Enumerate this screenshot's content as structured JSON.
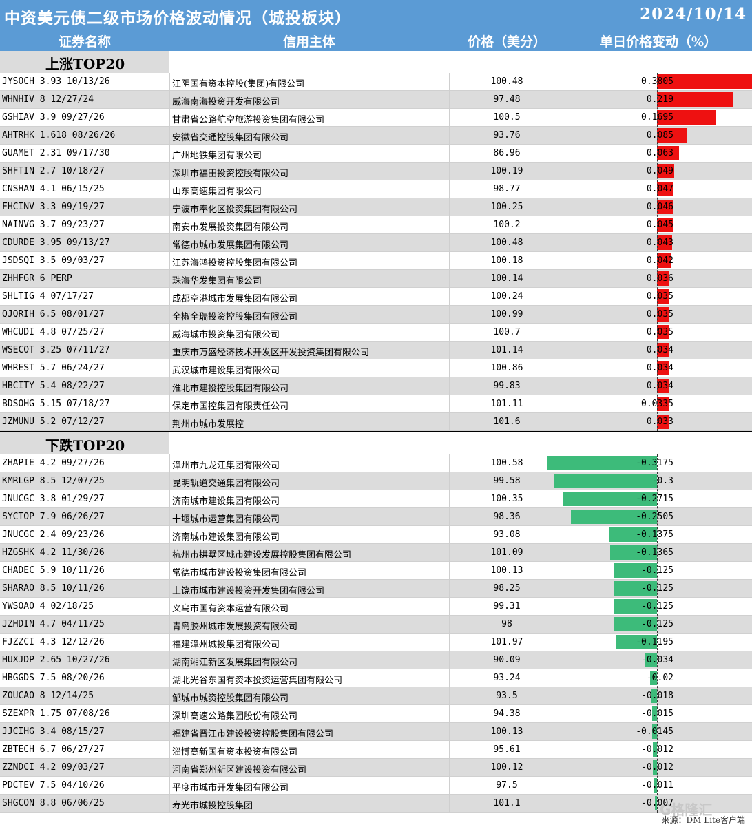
{
  "title": "中资美元债二级市场价格波动情况（城投板块）",
  "date": "2024/10/14",
  "columns": [
    "证券名称",
    "信用主体",
    "价格（美分）",
    "单日价格变动（%）"
  ],
  "sections": {
    "up_label": "上涨TOP20",
    "down_label": "下跌TOP20"
  },
  "colors": {
    "header": "#5b9bd5",
    "up": "#ee1111",
    "down": "#3dbb7a",
    "band": "#dcdcdc"
  },
  "chart_data": {
    "type": "table",
    "up": [
      {
        "bond": "JYSOCH 3.93 10/13/26",
        "issuer": "江阴国有资本控股(集团)有限公司",
        "price": "100.48",
        "change": "0.3805"
      },
      {
        "bond": "WHNHIV 8 12/27/24",
        "issuer": "威海南海投资开发有限公司",
        "price": "97.48",
        "change": "0.219"
      },
      {
        "bond": "GSHIAV 3.9 09/27/26",
        "issuer": "甘肃省公路航空旅游投资集团有限公司",
        "price": "100.5",
        "change": "0.1695"
      },
      {
        "bond": "AHTRHK 1.618 08/26/26",
        "issuer": "安徽省交通控股集团有限公司",
        "price": "93.76",
        "change": "0.085"
      },
      {
        "bond": "GUAMET 2.31 09/17/30",
        "issuer": "广州地铁集团有限公司",
        "price": "86.96",
        "change": "0.063"
      },
      {
        "bond": "SHFTIN 2.7 10/18/27",
        "issuer": "深圳市福田投资控股有限公司",
        "price": "100.19",
        "change": "0.049"
      },
      {
        "bond": "CNSHAN 4.1 06/15/25",
        "issuer": "山东高速集团有限公司",
        "price": "98.77",
        "change": "0.047"
      },
      {
        "bond": "FHCINV 3.3 09/19/27",
        "issuer": "宁波市奉化区投资集团有限公司",
        "price": "100.25",
        "change": "0.046"
      },
      {
        "bond": "NAINVG 3.7 09/23/27",
        "issuer": "南安市发展投资集团有限公司",
        "price": "100.2",
        "change": "0.045"
      },
      {
        "bond": "CDURDE 3.95 09/13/27",
        "issuer": "常德市城市发展集团有限公司",
        "price": "100.48",
        "change": "0.043"
      },
      {
        "bond": "JSDSQI 3.5 09/03/27",
        "issuer": "江苏海鸿投资控股集团有限公司",
        "price": "100.18",
        "change": "0.042"
      },
      {
        "bond": "ZHHFGR 6 PERP",
        "issuer": "珠海华发集团有限公司",
        "price": "100.14",
        "change": "0.036"
      },
      {
        "bond": "SHLTIG 4 07/17/27",
        "issuer": "成都空港城市发展集团有限公司",
        "price": "100.24",
        "change": "0.035"
      },
      {
        "bond": "QJQRIH 6.5 08/01/27",
        "issuer": "全椒全瑞投资控股集团有限公司",
        "price": "100.99",
        "change": "0.035"
      },
      {
        "bond": "WHCUDI 4.8 07/25/27",
        "issuer": "威海城市投资集团有限公司",
        "price": "100.7",
        "change": "0.035"
      },
      {
        "bond": "WSECOT 3.25 07/11/27",
        "issuer": "重庆市万盛经济技术开发区开发投资集团有限公司",
        "price": "101.14",
        "change": "0.034"
      },
      {
        "bond": "WHREST 5.7 06/24/27",
        "issuer": "武汉城市建设集团有限公司",
        "price": "100.86",
        "change": "0.034"
      },
      {
        "bond": "HBCITY 5.4 08/22/27",
        "issuer": "淮北市建投控股集团有限公司",
        "price": "99.83",
        "change": "0.034"
      },
      {
        "bond": "BDSOHG 5.15 07/18/27",
        "issuer": "保定市国控集团有限责任公司",
        "price": "101.11",
        "change": "0.0335"
      },
      {
        "bond": "JZMUNU 5.2 07/12/27",
        "issuer": "荆州市城市发展控",
        "price": "101.6",
        "change": "0.033"
      }
    ],
    "down": [
      {
        "bond": "ZHAPIE 4.2 09/27/26",
        "issuer": "漳州市九龙江集团有限公司",
        "price": "100.58",
        "change": "-0.3175"
      },
      {
        "bond": "KMRLGP 8.5 12/07/25",
        "issuer": "昆明轨道交通集团有限公司",
        "price": "99.58",
        "change": "-0.3"
      },
      {
        "bond": "JNUCGC 3.8 01/29/27",
        "issuer": "济南城市建设集团有限公司",
        "price": "100.35",
        "change": "-0.2715"
      },
      {
        "bond": "SYCTOP 7.9 06/26/27",
        "issuer": "十堰城市运营集团有限公司",
        "price": "98.36",
        "change": "-0.2505"
      },
      {
        "bond": "JNUCGC 2.4 09/23/26",
        "issuer": "济南城市建设集团有限公司",
        "price": "93.08",
        "change": "-0.1375"
      },
      {
        "bond": "HZGSHK 4.2 11/30/26",
        "issuer": "杭州市拱墅区城市建设发展控股集团有限公司",
        "price": "101.09",
        "change": "-0.1365"
      },
      {
        "bond": "CHADEC 5.9 10/11/26",
        "issuer": "常德市城市建设投资集团有限公司",
        "price": "100.13",
        "change": "-0.125"
      },
      {
        "bond": "SHARAO 8.5 10/11/26",
        "issuer": "上饶市城市建设投资开发集团有限公司",
        "price": "98.25",
        "change": "-0.125"
      },
      {
        "bond": "YWSOAO 4 02/18/25",
        "issuer": "义乌市国有资本运营有限公司",
        "price": "99.31",
        "change": "-0.125"
      },
      {
        "bond": "JZHDIN 4.7 04/11/25",
        "issuer": "青岛胶州城市发展投资有限公司",
        "price": "98",
        "change": "-0.125"
      },
      {
        "bond": "FJZZCI 4.3 12/12/26",
        "issuer": "福建漳州城投集团有限公司",
        "price": "101.97",
        "change": "-0.1195"
      },
      {
        "bond": "HUXJDP 2.65 10/27/26",
        "issuer": "湖南湘江新区发展集团有限公司",
        "price": "90.09",
        "change": "-0.034"
      },
      {
        "bond": "HBGGDS 7.5 08/20/26",
        "issuer": "湖北光谷东国有资本投资运营集团有限公司",
        "price": "93.24",
        "change": "-0.02"
      },
      {
        "bond": "ZOUCAO 8 12/14/25",
        "issuer": "邹城市城资控股集团有限公司",
        "price": "93.5",
        "change": "-0.018"
      },
      {
        "bond": "SZEXPR 1.75 07/08/26",
        "issuer": "深圳高速公路集团股份有限公司",
        "price": "94.38",
        "change": "-0.015"
      },
      {
        "bond": "JJCIHG 3.4 08/15/27",
        "issuer": "福建省晋江市建设投资控股集团有限公司",
        "price": "100.13",
        "change": "-0.0145"
      },
      {
        "bond": "ZBTECH 6.7 06/27/27",
        "issuer": "淄博高新国有资本投资有限公司",
        "price": "95.61",
        "change": "-0.012"
      },
      {
        "bond": "ZZNDCI 4.2 09/03/27",
        "issuer": "河南省郑州新区建设投资有限公司",
        "price": "100.12",
        "change": "-0.012"
      },
      {
        "bond": "PDCTEV 7.5 04/10/26",
        "issuer": "平度市城市开发集团有限公司",
        "price": "97.5",
        "change": "-0.011"
      },
      {
        "bond": "SHGCON 8.8 06/06/25",
        "issuer": "寿光市城投控股集团",
        "price": "101.1",
        "change": "-0.007"
      }
    ]
  },
  "footer": "来源：DM Lite客户端",
  "watermark": "格隆汇"
}
